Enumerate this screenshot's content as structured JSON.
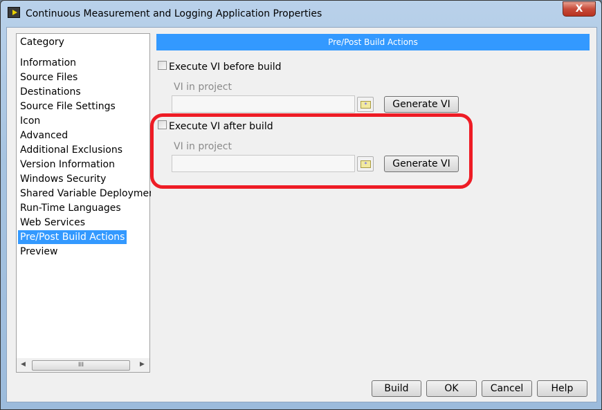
{
  "window": {
    "title": "Continuous Measurement and Logging Application Properties",
    "close": "X"
  },
  "sidebar": {
    "header": "Category",
    "selected": "Pre/Post Build Actions",
    "items": [
      "Information",
      "Source Files",
      "Destinations",
      "Source File Settings",
      "Icon",
      "Advanced",
      "Additional Exclusions",
      "Version Information",
      "Windows Security",
      "Shared Variable Deployment",
      "Run-Time Languages",
      "Web Services",
      "Pre/Post Build Actions",
      "Preview"
    ],
    "scroll_thumb": "III"
  },
  "panel": {
    "title": "Pre/Post Build Actions",
    "before": {
      "checkbox": "Execute VI before build",
      "checked": false,
      "field_label": "VI in project",
      "value": "",
      "button": "Generate  VI"
    },
    "after": {
      "checkbox": "Execute VI after build",
      "checked": false,
      "field_label": "VI in project",
      "value": "",
      "button": "Generate  VI"
    },
    "highlight_color": "#ee1c25"
  },
  "footer": {
    "build": "Build",
    "ok": "OK",
    "cancel": "Cancel",
    "help": "Help"
  }
}
